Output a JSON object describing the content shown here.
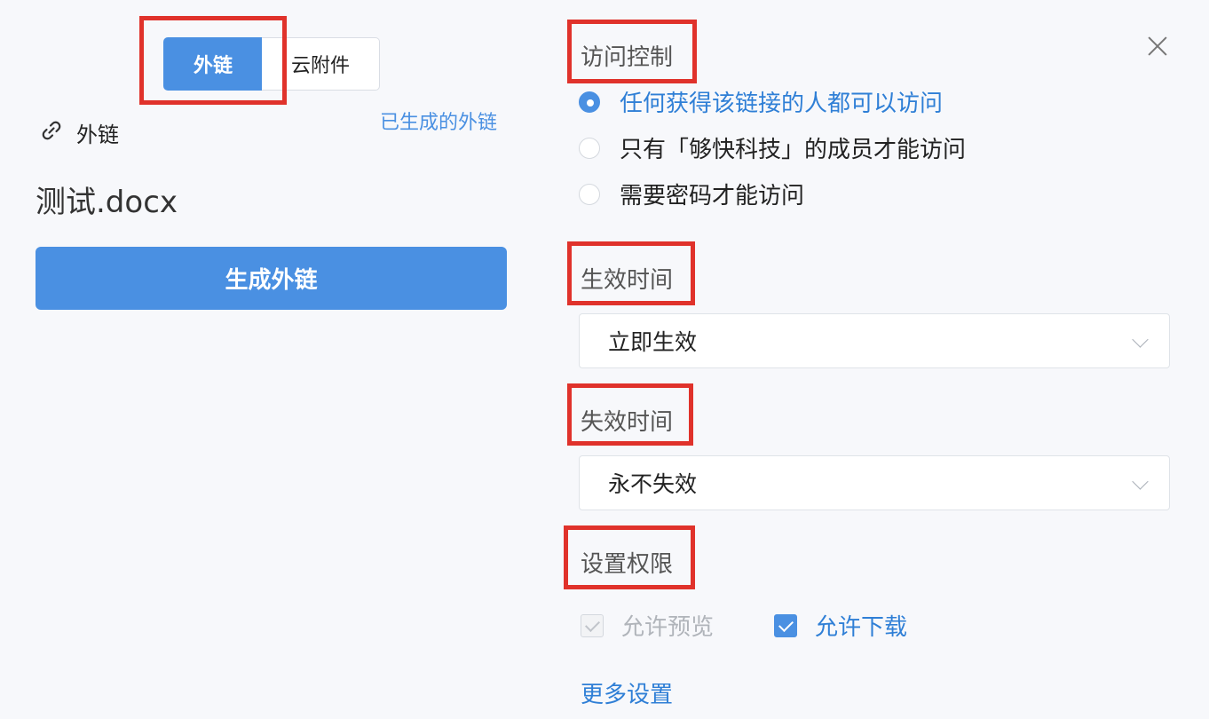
{
  "left": {
    "tabs": [
      {
        "label": "外链",
        "active": true
      },
      {
        "label": "云附件",
        "active": false
      }
    ],
    "section_label": "外链",
    "generated_link": "已生成的外链",
    "file_name": "测试.docx",
    "generate_button": "生成外链"
  },
  "right": {
    "access_control": {
      "title": "访问控制",
      "options": [
        {
          "label": "任何获得该链接的人都可以访问",
          "checked": true
        },
        {
          "label": "只有「够快科技」的成员才能访问",
          "checked": false
        },
        {
          "label": "需要密码才能访问",
          "checked": false
        }
      ]
    },
    "effective_time": {
      "title": "生效时间",
      "value": "立即生效"
    },
    "expiry_time": {
      "title": "失效时间",
      "value": "永不失效"
    },
    "permissions": {
      "title": "设置权限",
      "allow_preview": {
        "label": "允许预览",
        "checked": true,
        "disabled": true
      },
      "allow_download": {
        "label": "允许下载",
        "checked": true,
        "disabled": false
      }
    },
    "more_settings": "更多设置"
  },
  "icons": {
    "link": "link-icon",
    "close": "close-icon",
    "chevron": "chevron-down-icon"
  },
  "colors": {
    "accent": "#4a90e2",
    "highlight": "#e0322b"
  }
}
